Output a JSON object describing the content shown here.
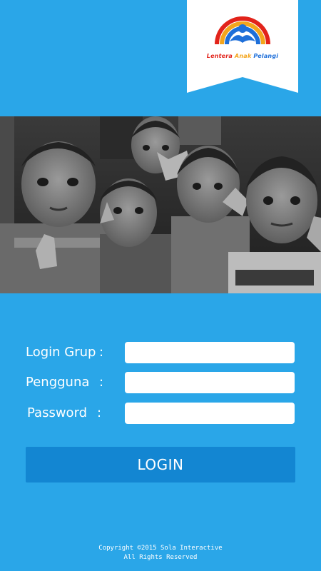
{
  "colors": {
    "background": "#2aa6e8",
    "button": "#1386d2",
    "input_background": "#ffffff",
    "text": "#ffffff"
  },
  "logo": {
    "icon": "rainbow-logo-icon",
    "words": [
      "Lentera",
      "Anak",
      "Pelangi"
    ]
  },
  "hero": {
    "icon": "hero-photo-children"
  },
  "form": {
    "fields": [
      {
        "label": "Login Grup",
        "colon": ":",
        "value": "",
        "placeholder": ""
      },
      {
        "label": "Pengguna",
        "colon": ":",
        "value": "",
        "placeholder": ""
      },
      {
        "label": "Password",
        "colon": ":",
        "value": "",
        "placeholder": ""
      }
    ],
    "login_label": "LOGIN"
  },
  "footer": {
    "line1": "Copyright ©2015 Sola Interactive",
    "line2": "All Rights Reserved"
  }
}
